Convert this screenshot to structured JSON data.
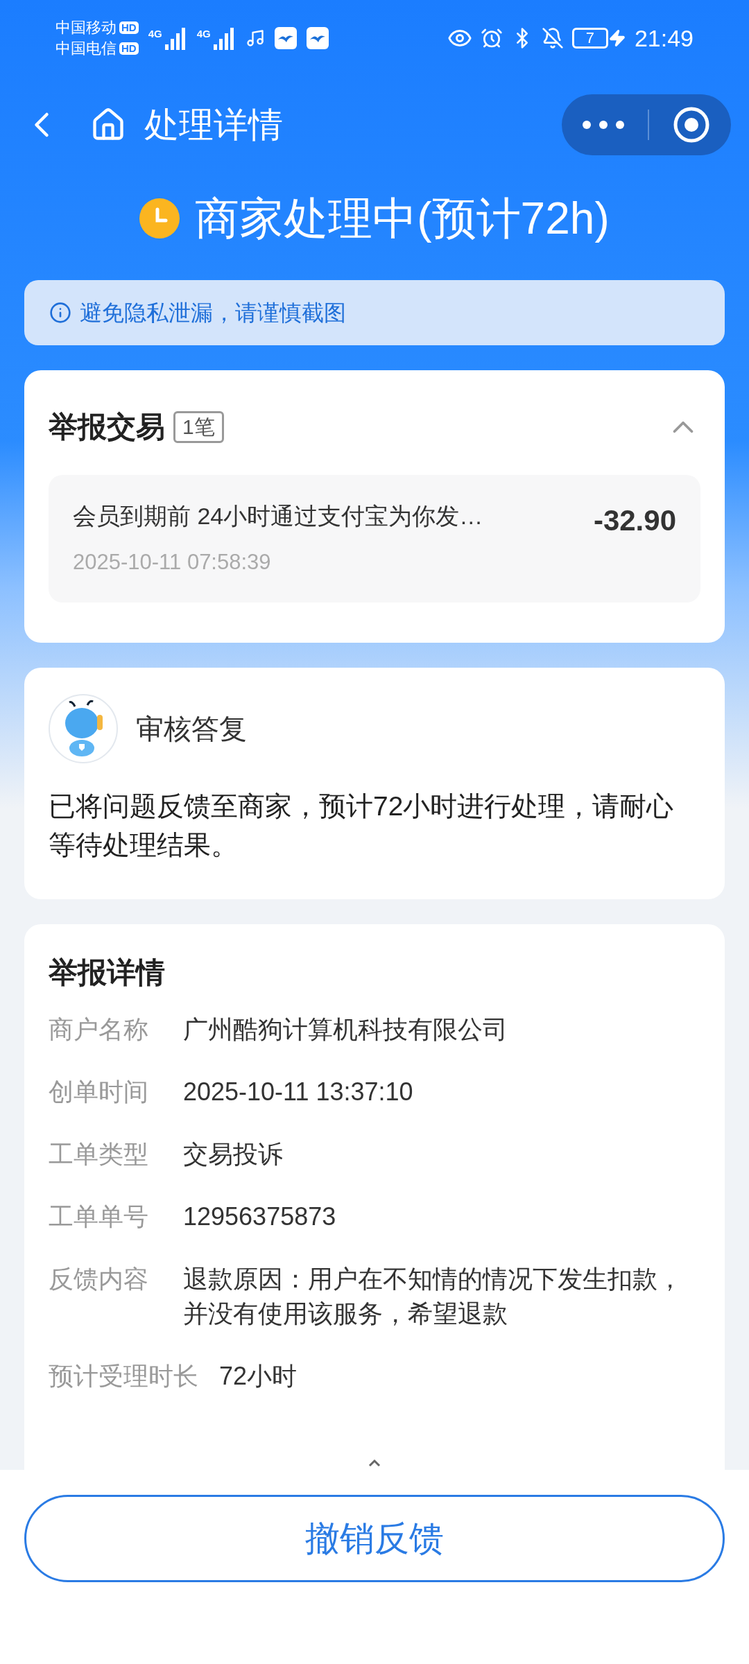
{
  "status_bar": {
    "carriers": [
      {
        "name": "中国移动",
        "badge": "HD"
      },
      {
        "name": "中国电信",
        "badge": "HD"
      }
    ],
    "networks": [
      "4G",
      "4G"
    ],
    "battery": "7",
    "time": "21:49"
  },
  "nav": {
    "title": "处理详情"
  },
  "status": {
    "title": "商家处理中(预计72h)"
  },
  "notice": {
    "text": "避免隐私泄漏，请谨慎截图"
  },
  "transaction_card": {
    "title": "举报交易",
    "count": "1笔",
    "expanded": true,
    "items": [
      {
        "description": "会员到期前 24小时通过支付宝为你发…",
        "amount": "-32.90",
        "time": "2025-10-11 07:58:39"
      }
    ]
  },
  "review_card": {
    "title": "审核答复",
    "message": "已将问题反馈至商家，预计72小时进行处理，请耐心等待处理结果。"
  },
  "details_card": {
    "title": "举报详情",
    "rows": [
      {
        "label": "商户名称",
        "value": "广州酷狗计算机科技有限公司"
      },
      {
        "label": "创单时间",
        "value": "2025-10-11 13:37:10"
      },
      {
        "label": "工单类型",
        "value": "交易投诉"
      },
      {
        "label": "工单单号",
        "value": "12956375873"
      },
      {
        "label": "反馈内容",
        "value": "退款原因：用户在不知情的情况下发生扣款，并没有使用该服务，希望退款"
      },
      {
        "label": "预计受理时长",
        "value": "72小时"
      }
    ]
  },
  "footer": {
    "button": "撤销反馈"
  }
}
